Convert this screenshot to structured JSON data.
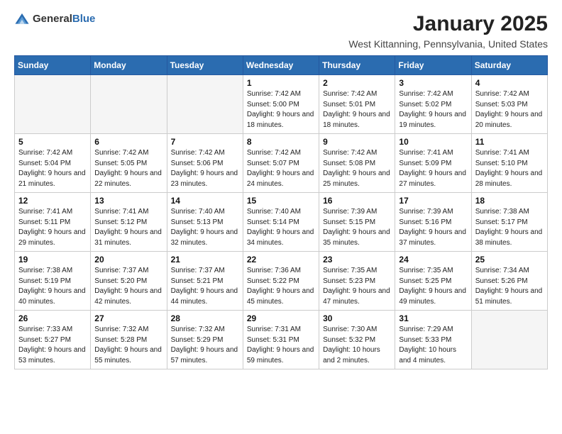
{
  "logo": {
    "general": "General",
    "blue": "Blue"
  },
  "header": {
    "month": "January 2025",
    "location": "West Kittanning, Pennsylvania, United States"
  },
  "weekdays": [
    "Sunday",
    "Monday",
    "Tuesday",
    "Wednesday",
    "Thursday",
    "Friday",
    "Saturday"
  ],
  "weeks": [
    [
      {
        "day": "",
        "empty": true
      },
      {
        "day": "",
        "empty": true
      },
      {
        "day": "",
        "empty": true
      },
      {
        "day": "1",
        "sunrise": "7:42 AM",
        "sunset": "5:00 PM",
        "daylight": "9 hours and 18 minutes."
      },
      {
        "day": "2",
        "sunrise": "7:42 AM",
        "sunset": "5:01 PM",
        "daylight": "9 hours and 18 minutes."
      },
      {
        "day": "3",
        "sunrise": "7:42 AM",
        "sunset": "5:02 PM",
        "daylight": "9 hours and 19 minutes."
      },
      {
        "day": "4",
        "sunrise": "7:42 AM",
        "sunset": "5:03 PM",
        "daylight": "9 hours and 20 minutes."
      }
    ],
    [
      {
        "day": "5",
        "sunrise": "7:42 AM",
        "sunset": "5:04 PM",
        "daylight": "9 hours and 21 minutes."
      },
      {
        "day": "6",
        "sunrise": "7:42 AM",
        "sunset": "5:05 PM",
        "daylight": "9 hours and 22 minutes."
      },
      {
        "day": "7",
        "sunrise": "7:42 AM",
        "sunset": "5:06 PM",
        "daylight": "9 hours and 23 minutes."
      },
      {
        "day": "8",
        "sunrise": "7:42 AM",
        "sunset": "5:07 PM",
        "daylight": "9 hours and 24 minutes."
      },
      {
        "day": "9",
        "sunrise": "7:42 AM",
        "sunset": "5:08 PM",
        "daylight": "9 hours and 25 minutes."
      },
      {
        "day": "10",
        "sunrise": "7:41 AM",
        "sunset": "5:09 PM",
        "daylight": "9 hours and 27 minutes."
      },
      {
        "day": "11",
        "sunrise": "7:41 AM",
        "sunset": "5:10 PM",
        "daylight": "9 hours and 28 minutes."
      }
    ],
    [
      {
        "day": "12",
        "sunrise": "7:41 AM",
        "sunset": "5:11 PM",
        "daylight": "9 hours and 29 minutes."
      },
      {
        "day": "13",
        "sunrise": "7:41 AM",
        "sunset": "5:12 PM",
        "daylight": "9 hours and 31 minutes."
      },
      {
        "day": "14",
        "sunrise": "7:40 AM",
        "sunset": "5:13 PM",
        "daylight": "9 hours and 32 minutes."
      },
      {
        "day": "15",
        "sunrise": "7:40 AM",
        "sunset": "5:14 PM",
        "daylight": "9 hours and 34 minutes."
      },
      {
        "day": "16",
        "sunrise": "7:39 AM",
        "sunset": "5:15 PM",
        "daylight": "9 hours and 35 minutes."
      },
      {
        "day": "17",
        "sunrise": "7:39 AM",
        "sunset": "5:16 PM",
        "daylight": "9 hours and 37 minutes."
      },
      {
        "day": "18",
        "sunrise": "7:38 AM",
        "sunset": "5:17 PM",
        "daylight": "9 hours and 38 minutes."
      }
    ],
    [
      {
        "day": "19",
        "sunrise": "7:38 AM",
        "sunset": "5:19 PM",
        "daylight": "9 hours and 40 minutes."
      },
      {
        "day": "20",
        "sunrise": "7:37 AM",
        "sunset": "5:20 PM",
        "daylight": "9 hours and 42 minutes."
      },
      {
        "day": "21",
        "sunrise": "7:37 AM",
        "sunset": "5:21 PM",
        "daylight": "9 hours and 44 minutes."
      },
      {
        "day": "22",
        "sunrise": "7:36 AM",
        "sunset": "5:22 PM",
        "daylight": "9 hours and 45 minutes."
      },
      {
        "day": "23",
        "sunrise": "7:35 AM",
        "sunset": "5:23 PM",
        "daylight": "9 hours and 47 minutes."
      },
      {
        "day": "24",
        "sunrise": "7:35 AM",
        "sunset": "5:25 PM",
        "daylight": "9 hours and 49 minutes."
      },
      {
        "day": "25",
        "sunrise": "7:34 AM",
        "sunset": "5:26 PM",
        "daylight": "9 hours and 51 minutes."
      }
    ],
    [
      {
        "day": "26",
        "sunrise": "7:33 AM",
        "sunset": "5:27 PM",
        "daylight": "9 hours and 53 minutes."
      },
      {
        "day": "27",
        "sunrise": "7:32 AM",
        "sunset": "5:28 PM",
        "daylight": "9 hours and 55 minutes."
      },
      {
        "day": "28",
        "sunrise": "7:32 AM",
        "sunset": "5:29 PM",
        "daylight": "9 hours and 57 minutes."
      },
      {
        "day": "29",
        "sunrise": "7:31 AM",
        "sunset": "5:31 PM",
        "daylight": "9 hours and 59 minutes."
      },
      {
        "day": "30",
        "sunrise": "7:30 AM",
        "sunset": "5:32 PM",
        "daylight": "10 hours and 2 minutes."
      },
      {
        "day": "31",
        "sunrise": "7:29 AM",
        "sunset": "5:33 PM",
        "daylight": "10 hours and 4 minutes."
      },
      {
        "day": "",
        "empty": true
      }
    ]
  ]
}
